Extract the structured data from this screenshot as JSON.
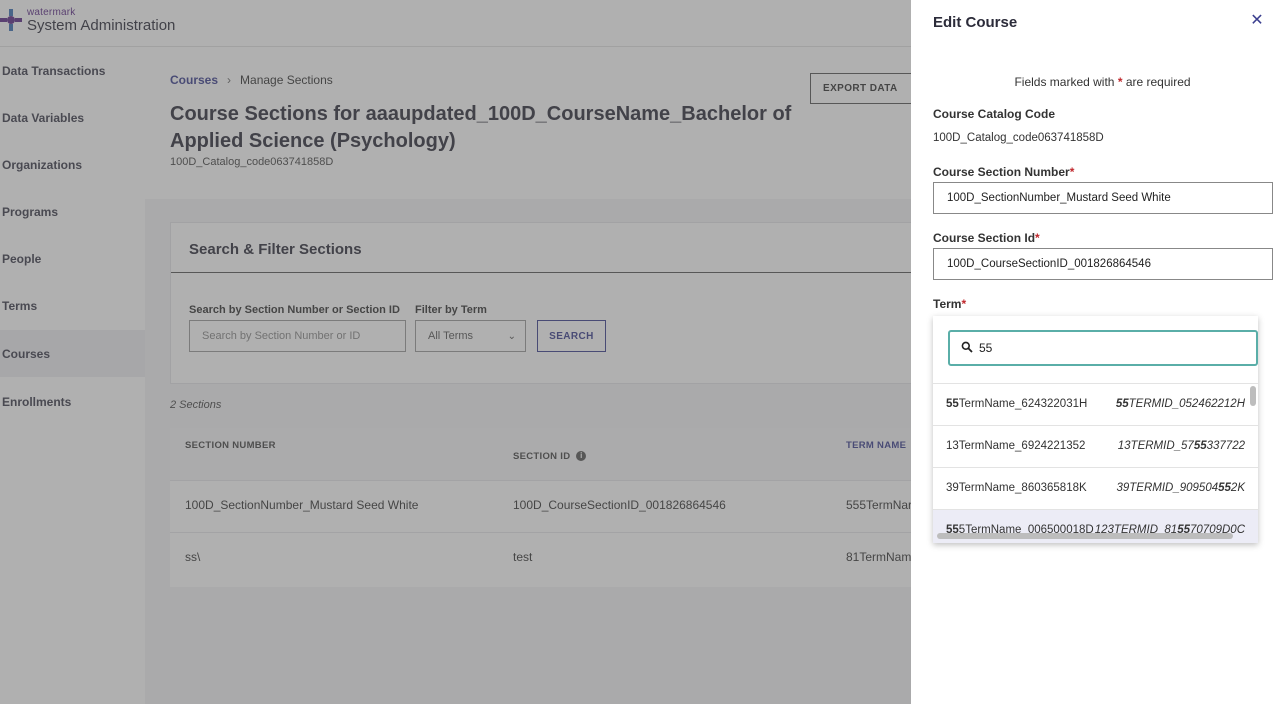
{
  "header": {
    "brand_small": "watermark",
    "app_title": "System Administration"
  },
  "sidebar": {
    "items": [
      {
        "label": "Data Transactions"
      },
      {
        "label": "Data Variables"
      },
      {
        "label": "Organizations"
      },
      {
        "label": "Programs"
      },
      {
        "label": "People"
      },
      {
        "label": "Terms"
      },
      {
        "label": "Courses",
        "active": true
      },
      {
        "label": "Enrollments"
      }
    ]
  },
  "breadcrumb": {
    "parent": "Courses",
    "separator": "›",
    "current": "Manage Sections"
  },
  "page": {
    "title": "Course Sections for aaaupdated_100D_CourseName_Bachelor of Applied Science (Psychology)",
    "subtitle": "100D_Catalog_code063741858D",
    "export_label": "EXPORT DATA"
  },
  "filter": {
    "title": "Search & Filter Sections",
    "search_label": "Search by Section Number or Section ID",
    "search_placeholder": "Search by Section Number or ID",
    "term_label": "Filter by Term",
    "term_value": "All Terms",
    "search_button": "SEARCH"
  },
  "table": {
    "count": "2 Sections",
    "headers": [
      "SECTION NUMBER",
      "SECTION ID",
      "TERM NAME"
    ],
    "rows": [
      [
        "100D_SectionNumber_Mustard Seed White",
        "100D_CourseSectionID_001826864546",
        "555TermNar"
      ],
      [
        "ss\\",
        "test",
        "81TermNam"
      ]
    ]
  },
  "drawer": {
    "title": "Edit Course",
    "required_note_pre": "Fields marked with ",
    "required_star": "*",
    "required_note_post": " are required",
    "catalog_label": "Course Catalog Code",
    "catalog_value": "100D_Catalog_code063741858D",
    "section_number_label": "Course Section Number",
    "section_number_value": "100D_SectionNumber_Mustard Seed White",
    "section_id_label": "Course Section Id",
    "section_id_value": "100D_CourseSectionID_001826864546",
    "term_label": "Term"
  },
  "term_dropdown": {
    "query": "55",
    "options": [
      {
        "name_pre": "",
        "name_match": "55",
        "name_post": "TermName_624322031H",
        "id_pre": "",
        "id_match": "55",
        "id_post": "TERMID_052462212H"
      },
      {
        "name_pre": "13TermName_6924221352",
        "name_match": "",
        "name_post": "",
        "id_pre": "13TERMID_57",
        "id_match": "55",
        "id_post": "337722"
      },
      {
        "name_pre": "39TermName_860365818K",
        "name_match": "",
        "name_post": "",
        "id_pre": "39TERMID_909504",
        "id_match": "55",
        "id_post": "2K"
      },
      {
        "name_pre": "",
        "name_match": "55",
        "name_post": "5TermName_006500018D",
        "id_pre": "123TERMID_81",
        "id_match": "55",
        "id_post": "70709D0C"
      }
    ]
  },
  "colors": {
    "accent": "#3b3f8f",
    "required": "#c0282d",
    "focus": "#5aaea8"
  }
}
